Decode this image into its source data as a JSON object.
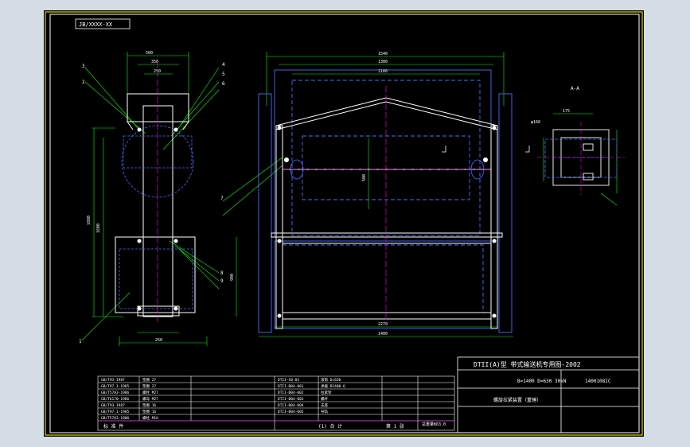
{
  "drawing": {
    "code_tag": "JB/XXXX-XX",
    "section_label": "A-A",
    "callouts_left": [
      "3",
      "2",
      "1"
    ],
    "callouts_right": [
      "4",
      "5",
      "6"
    ],
    "callouts_mid": [
      "7",
      "8",
      "9"
    ],
    "dim_labels": {
      "top_width": "1540",
      "top_width_2": "1300",
      "top_width_3": "1160",
      "left_width_1": "500",
      "left_width_2": "350",
      "left_width_3": "250",
      "bottom_width": "2270",
      "bottom_width_2": "1400",
      "left_height": "1880",
      "left_height_2": "1600",
      "section_dim": "175",
      "section_dim_2": "φ160",
      "side_dim": "900",
      "center_dim": "500"
    }
  },
  "title_block": {
    "title_line": "DTII(A)型  带式输送机专用图-2002",
    "spec": "B=1400  D=630  30kN",
    "drawing_no": "1400108IC",
    "name": "螺旋拉紧装置（重锤）",
    "footer_left": "标  准  件",
    "footer_mid": "(1)  合  计",
    "footer_right": "第  1  张",
    "weight_label": "总重量：",
    "weight_value": "663.0"
  },
  "parts_table": {
    "left": [
      "GB/T93-1987",
      "GB/T97.1-1985",
      "GB/T5783-1986",
      "GB/T6170-1986",
      "GB/T93-1987",
      "GB/T97.1-1985",
      "GB/T5783-1986"
    ],
    "left_names": [
      "垫圈 27",
      "垫圈 27",
      "螺栓 M27",
      "螺母 M27",
      "垫圈 16",
      "垫圈 16",
      "螺栓 M16"
    ],
    "mid": [
      "DTII-S0-03",
      "DTII-B04-001",
      "DTII-B04-002",
      "DTII-B04-003",
      "DTII-B04-004",
      "DTII-B04-005"
    ],
    "mid_names": [
      "滚筒 D=630",
      "承载 B1400-Q",
      "拉紧架",
      "螺杆",
      "支座",
      "导轨"
    ]
  }
}
